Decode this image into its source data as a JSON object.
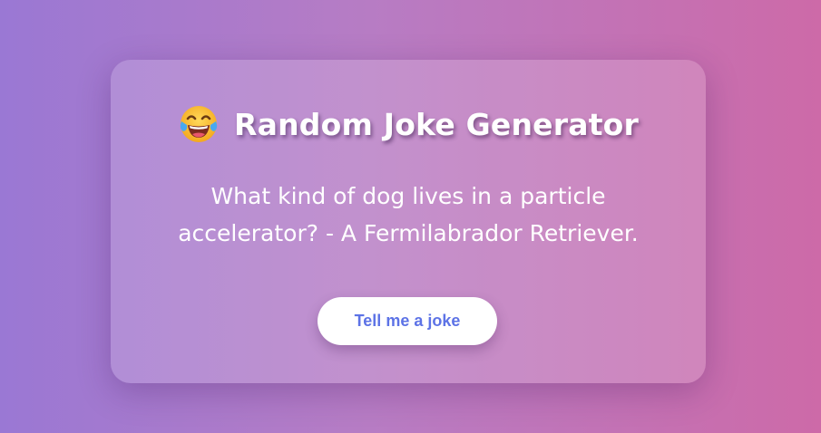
{
  "card": {
    "title_icon": "face-with-tears-of-joy-icon",
    "title": "Random Joke Generator",
    "joke": "What kind of dog lives in a particle accelerator? - A Fermilabrador Retriever.",
    "button_label": "Tell me a joke"
  },
  "colors": {
    "background_gradient": [
      "#9a78d4",
      "#b77cc4",
      "#cd6aa8"
    ],
    "button_text": "#5d73e6",
    "button_bg": "#ffffff",
    "text": "#ffffff"
  }
}
